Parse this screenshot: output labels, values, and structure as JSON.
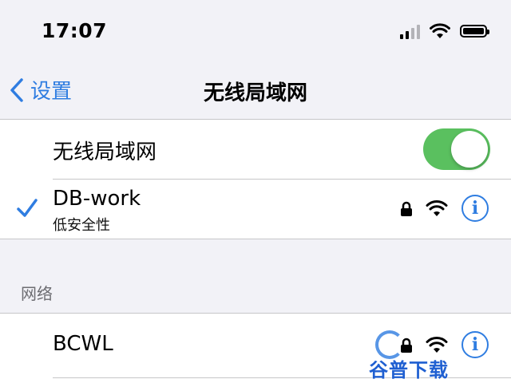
{
  "status_bar": {
    "time": "17:07",
    "icons": [
      "cellular-signal-icon",
      "wifi-icon",
      "battery-icon"
    ]
  },
  "nav": {
    "back_label": "设置",
    "title": "无线局域网"
  },
  "wifi_toggle": {
    "label": "无线局域网",
    "enabled": true
  },
  "current_network": {
    "name": "DB-work",
    "subtitle": "低安全性",
    "connected": true,
    "icons": [
      "lock-icon",
      "wifi-icon",
      "info-icon"
    ]
  },
  "networks_section": {
    "header": "网络",
    "items": [
      {
        "name": "BCWL",
        "icons": [
          "lock-icon",
          "wifi-icon",
          "info-icon"
        ]
      }
    ]
  },
  "watermark": {
    "text": "谷普下载"
  },
  "colors": {
    "accent": "#2f7de1",
    "toggle_on": "#5ac05f",
    "background": "#f2f2f7",
    "separator": "#c6c6c8",
    "watermark": "#1f5fd1"
  }
}
